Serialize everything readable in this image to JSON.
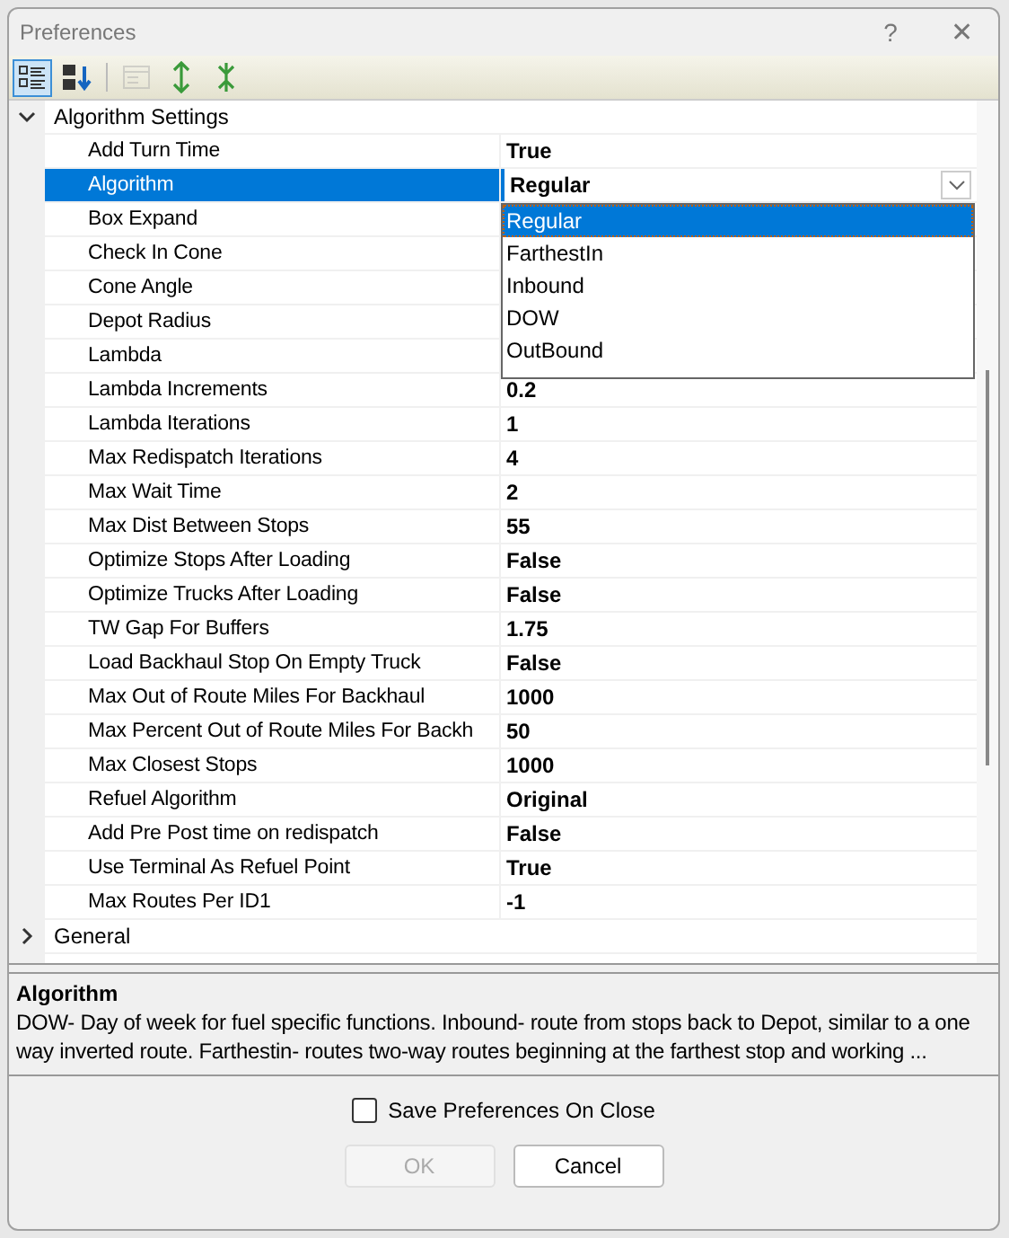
{
  "window": {
    "title": "Preferences",
    "help": "?",
    "close": "✕"
  },
  "toolbar": [
    {
      "kind": "categorized",
      "selected": true,
      "disabled": false
    },
    {
      "kind": "alphabetical",
      "selected": false,
      "disabled": false
    },
    {
      "kind": "pages",
      "selected": false,
      "disabled": true
    },
    {
      "kind": "expand",
      "selected": false,
      "disabled": false
    },
    {
      "kind": "collapse",
      "selected": false,
      "disabled": false
    }
  ],
  "categories": [
    {
      "name": "Algorithm Settings",
      "expanded": true,
      "children": [
        {
          "name": "Add Turn Time",
          "value": "True",
          "selected": false
        },
        {
          "name": "Algorithm",
          "value": "Regular",
          "selected": true,
          "dropdown": {
            "open": true,
            "options": [
              {
                "label": "Regular",
                "selected": true
              },
              {
                "label": "FarthestIn",
                "selected": false
              },
              {
                "label": "Inbound",
                "selected": false
              },
              {
                "label": "DOW",
                "selected": false
              },
              {
                "label": "OutBound",
                "selected": false
              }
            ]
          }
        },
        {
          "name": "Box Expand",
          "selected": false
        },
        {
          "name": "Check In Cone",
          "selected": false
        },
        {
          "name": "Cone Angle",
          "selected": false
        },
        {
          "name": "Depot Radius",
          "selected": false
        },
        {
          "name": "Lambda",
          "selected": false
        },
        {
          "name": "Lambda Increments",
          "value": "0.2",
          "selected": false
        },
        {
          "name": "Lambda Iterations",
          "value": "1",
          "selected": false
        },
        {
          "name": "Max Redispatch Iterations",
          "value": "4",
          "selected": false
        },
        {
          "name": "Max Wait Time",
          "value": "2",
          "selected": false
        },
        {
          "name": "Max Dist Between Stops",
          "value": "55",
          "selected": false
        },
        {
          "name": "Optimize Stops After Loading",
          "value": "False",
          "selected": false
        },
        {
          "name": "Optimize Trucks After Loading",
          "value": "False",
          "selected": false
        },
        {
          "name": "TW Gap For Buffers",
          "value": "1.75",
          "selected": false
        },
        {
          "name": "Load Backhaul Stop On Empty Truck",
          "value": "False",
          "selected": false
        },
        {
          "name": "Max Out of Route Miles For Backhaul",
          "value": "1000",
          "selected": false
        },
        {
          "name": "Max Percent Out of Route Miles For Backh",
          "value": "50",
          "selected": false
        },
        {
          "name": "Max Closest Stops",
          "value": "1000",
          "selected": false
        },
        {
          "name": "Refuel Algorithm",
          "value": "Original",
          "selected": false
        },
        {
          "name": "Add Pre Post time on redispatch",
          "value": "False",
          "selected": false
        },
        {
          "name": "Use Terminal As Refuel Point",
          "value": "True",
          "selected": false
        },
        {
          "name": "Max Routes Per ID1",
          "value": "-1",
          "selected": false
        }
      ]
    },
    {
      "name": "General",
      "expanded": false
    }
  ],
  "description": {
    "title": "Algorithm",
    "text": "DOW- Day of week for  fuel specific functions. Inbound- route from stops back to Depot, similar to a one way inverted route. Farthestin- routes two-way routes beginning at the farthest stop and working ..."
  },
  "save_on_close": {
    "label": "Save Preferences On Close",
    "checked": false
  },
  "buttons": [
    {
      "label": "OK",
      "disabled": true
    },
    {
      "label": "Cancel",
      "disabled": false
    }
  ]
}
